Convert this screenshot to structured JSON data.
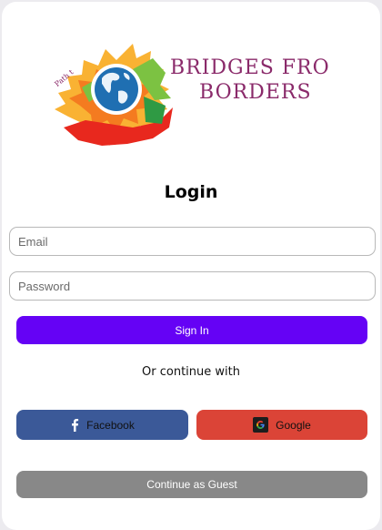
{
  "brand": {
    "line1": "BRIDGES FROM",
    "line2": "BORDERS",
    "tagline": "Path t",
    "color": "#8a2a6a"
  },
  "login": {
    "title": "Login",
    "email_placeholder": "Email",
    "password_placeholder": "Password",
    "signin_label": "Sign In",
    "divider_text": "Or continue with",
    "facebook_label": "Facebook",
    "google_label": "Google",
    "guest_label": "Continue as Guest"
  },
  "colors": {
    "signin": "#6502f5",
    "facebook": "#3b5998",
    "google": "#db4437",
    "guest": "#888888"
  },
  "icons": {
    "facebook": "facebook-icon",
    "google": "google-icon",
    "logo": "globe-logo-icon"
  }
}
